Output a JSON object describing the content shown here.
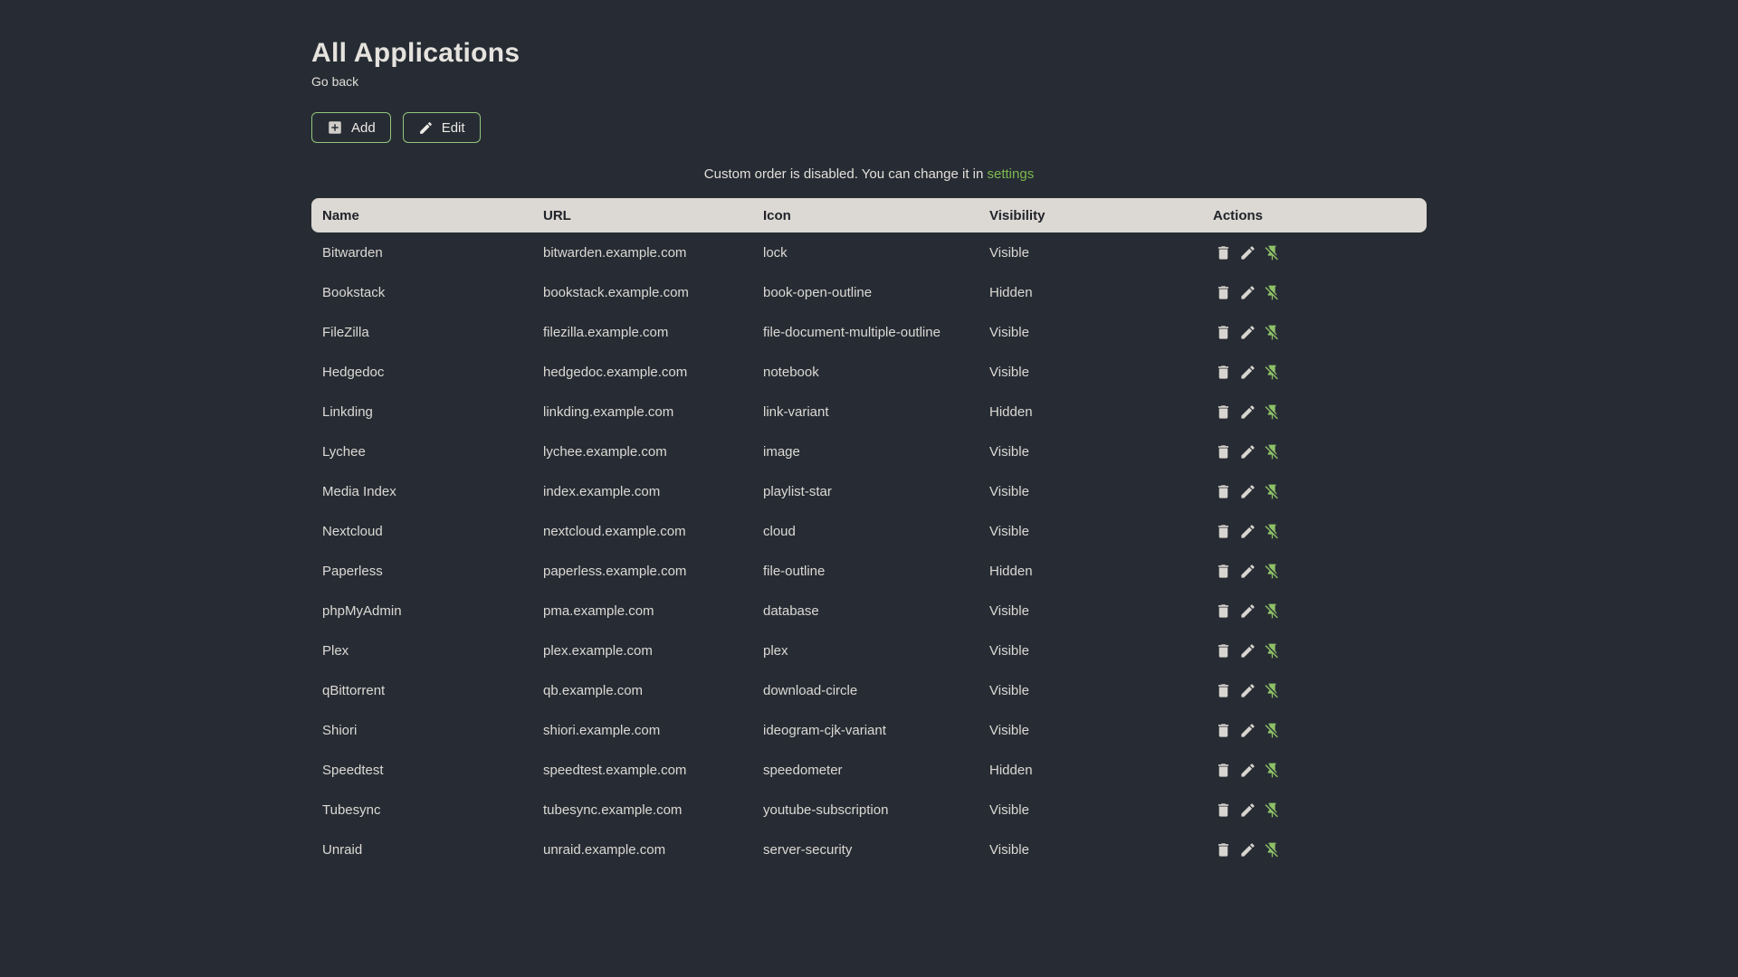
{
  "colors": {
    "background": "#272c34",
    "table_header_bg": "#dcd8d3",
    "table_header_text": "#20232a",
    "body_text": "#dcd9d4",
    "accent_green": "#7cb84f",
    "button_border_green": "#93c77d",
    "icon_light": "#d8d5d0"
  },
  "header": {
    "title": "All Applications",
    "back_label": "Go back"
  },
  "toolbar": {
    "add_label": "Add",
    "edit_label": "Edit",
    "add_icon": "plus-box-icon",
    "edit_icon": "pencil-icon"
  },
  "notice": {
    "text": "Custom order is disabled. You can change it in ",
    "link_label": "settings"
  },
  "table": {
    "columns": [
      "Name",
      "URL",
      "Icon",
      "Visibility",
      "Actions"
    ],
    "action_icons": [
      "trash-icon",
      "pencil-icon",
      "pin-off-icon"
    ],
    "rows": [
      {
        "name": "Bitwarden",
        "url": "bitwarden.example.com",
        "icon": "lock",
        "visibility": "Visible"
      },
      {
        "name": "Bookstack",
        "url": "bookstack.example.com",
        "icon": "book-open-outline",
        "visibility": "Hidden"
      },
      {
        "name": "FileZilla",
        "url": "filezilla.example.com",
        "icon": "file-document-multiple-outline",
        "visibility": "Visible"
      },
      {
        "name": "Hedgedoc",
        "url": "hedgedoc.example.com",
        "icon": "notebook",
        "visibility": "Visible"
      },
      {
        "name": "Linkding",
        "url": "linkding.example.com",
        "icon": "link-variant",
        "visibility": "Hidden"
      },
      {
        "name": "Lychee",
        "url": "lychee.example.com",
        "icon": "image",
        "visibility": "Visible"
      },
      {
        "name": "Media Index",
        "url": "index.example.com",
        "icon": "playlist-star",
        "visibility": "Visible"
      },
      {
        "name": "Nextcloud",
        "url": "nextcloud.example.com",
        "icon": "cloud",
        "visibility": "Visible"
      },
      {
        "name": "Paperless",
        "url": "paperless.example.com",
        "icon": "file-outline",
        "visibility": "Hidden"
      },
      {
        "name": "phpMyAdmin",
        "url": "pma.example.com",
        "icon": "database",
        "visibility": "Visible"
      },
      {
        "name": "Plex",
        "url": "plex.example.com",
        "icon": "plex",
        "visibility": "Visible"
      },
      {
        "name": "qBittorrent",
        "url": "qb.example.com",
        "icon": "download-circle",
        "visibility": "Visible"
      },
      {
        "name": "Shiori",
        "url": "shiori.example.com",
        "icon": "ideogram-cjk-variant",
        "visibility": "Visible"
      },
      {
        "name": "Speedtest",
        "url": "speedtest.example.com",
        "icon": "speedometer",
        "visibility": "Hidden"
      },
      {
        "name": "Tubesync",
        "url": "tubesync.example.com",
        "icon": "youtube-subscription",
        "visibility": "Visible"
      },
      {
        "name": "Unraid",
        "url": "unraid.example.com",
        "icon": "server-security",
        "visibility": "Visible"
      }
    ]
  }
}
